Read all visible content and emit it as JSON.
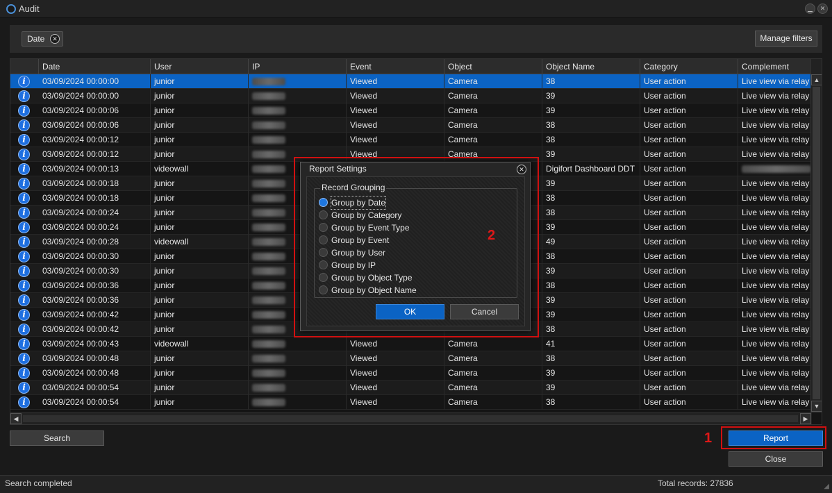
{
  "window": {
    "title": "Audit",
    "icon": "audit-app-icon"
  },
  "filters": {
    "chips": [
      {
        "label": "Date"
      }
    ],
    "manage_label": "Manage filters"
  },
  "table": {
    "columns": [
      "",
      "Date",
      "User",
      "IP",
      "Event",
      "Object",
      "Object Name",
      "Category",
      "Complement"
    ],
    "rows": [
      {
        "date": "03/09/2024 00:00:00",
        "user": "junior",
        "event": "Viewed",
        "object": "Camera",
        "object_name": "38",
        "category": "User action",
        "complement": "Live view via relay",
        "selected": true
      },
      {
        "date": "03/09/2024 00:00:00",
        "user": "junior",
        "event": "Viewed",
        "object": "Camera",
        "object_name": "39",
        "category": "User action",
        "complement": "Live view via relay"
      },
      {
        "date": "03/09/2024 00:00:06",
        "user": "junior",
        "event": "Viewed",
        "object": "Camera",
        "object_name": "39",
        "category": "User action",
        "complement": "Live view via relay"
      },
      {
        "date": "03/09/2024 00:00:06",
        "user": "junior",
        "event": "Viewed",
        "object": "Camera",
        "object_name": "38",
        "category": "User action",
        "complement": "Live view via relay"
      },
      {
        "date": "03/09/2024 00:00:12",
        "user": "junior",
        "event": "Viewed",
        "object": "Camera",
        "object_name": "38",
        "category": "User action",
        "complement": "Live view via relay"
      },
      {
        "date": "03/09/2024 00:00:12",
        "user": "junior",
        "event": "Viewed",
        "object": "Camera",
        "object_name": "39",
        "category": "User action",
        "complement": "Live view via relay"
      },
      {
        "date": "03/09/2024 00:00:13",
        "user": "videowall",
        "event": "",
        "object": "",
        "object_name": "Digifort Dashboard DDT",
        "category": "User action",
        "complement": ""
      },
      {
        "date": "03/09/2024 00:00:18",
        "user": "junior",
        "event": "",
        "object": "",
        "object_name": "39",
        "category": "User action",
        "complement": "Live view via relay"
      },
      {
        "date": "03/09/2024 00:00:18",
        "user": "junior",
        "event": "",
        "object": "",
        "object_name": "38",
        "category": "User action",
        "complement": "Live view via relay"
      },
      {
        "date": "03/09/2024 00:00:24",
        "user": "junior",
        "event": "",
        "object": "",
        "object_name": "38",
        "category": "User action",
        "complement": "Live view via relay"
      },
      {
        "date": "03/09/2024 00:00:24",
        "user": "junior",
        "event": "",
        "object": "",
        "object_name": "39",
        "category": "User action",
        "complement": "Live view via relay"
      },
      {
        "date": "03/09/2024 00:00:28",
        "user": "videowall",
        "event": "",
        "object": "",
        "object_name": "49",
        "category": "User action",
        "complement": "Live view via relay"
      },
      {
        "date": "03/09/2024 00:00:30",
        "user": "junior",
        "event": "",
        "object": "",
        "object_name": "38",
        "category": "User action",
        "complement": "Live view via relay"
      },
      {
        "date": "03/09/2024 00:00:30",
        "user": "junior",
        "event": "",
        "object": "",
        "object_name": "39",
        "category": "User action",
        "complement": "Live view via relay"
      },
      {
        "date": "03/09/2024 00:00:36",
        "user": "junior",
        "event": "",
        "object": "",
        "object_name": "38",
        "category": "User action",
        "complement": "Live view via relay"
      },
      {
        "date": "03/09/2024 00:00:36",
        "user": "junior",
        "event": "",
        "object": "",
        "object_name": "39",
        "category": "User action",
        "complement": "Live view via relay"
      },
      {
        "date": "03/09/2024 00:00:42",
        "user": "junior",
        "event": "",
        "object": "",
        "object_name": "39",
        "category": "User action",
        "complement": "Live view via relay"
      },
      {
        "date": "03/09/2024 00:00:42",
        "user": "junior",
        "event": "",
        "object": "",
        "object_name": "38",
        "category": "User action",
        "complement": "Live view via relay"
      },
      {
        "date": "03/09/2024 00:00:43",
        "user": "videowall",
        "event": "Viewed",
        "object": "Camera",
        "object_name": "41",
        "category": "User action",
        "complement": "Live view via relay"
      },
      {
        "date": "03/09/2024 00:00:48",
        "user": "junior",
        "event": "Viewed",
        "object": "Camera",
        "object_name": "38",
        "category": "User action",
        "complement": "Live view via relay"
      },
      {
        "date": "03/09/2024 00:00:48",
        "user": "junior",
        "event": "Viewed",
        "object": "Camera",
        "object_name": "39",
        "category": "User action",
        "complement": "Live view via relay"
      },
      {
        "date": "03/09/2024 00:00:54",
        "user": "junior",
        "event": "Viewed",
        "object": "Camera",
        "object_name": "39",
        "category": "User action",
        "complement": "Live view via relay"
      },
      {
        "date": "03/09/2024 00:00:54",
        "user": "junior",
        "event": "Viewed",
        "object": "Camera",
        "object_name": "38",
        "category": "User action",
        "complement": "Live view via relay"
      }
    ]
  },
  "dialog": {
    "title": "Report Settings",
    "group_label": "Record Grouping",
    "options": [
      "Group by Date",
      "Group by Category",
      "Group by Event Type",
      "Group by Event",
      "Group by User",
      "Group by IP",
      "Group by Object Type",
      "Group by Object Name"
    ],
    "selected_index": 0,
    "ok_label": "OK",
    "cancel_label": "Cancel"
  },
  "buttons": {
    "search_label": "Search",
    "report_label": "Report",
    "close_label": "Close"
  },
  "annotations": {
    "step1": "1",
    "step2": "2"
  },
  "status": {
    "left": "Search completed",
    "right": "Total records: 27836"
  },
  "colors": {
    "accent": "#0b63c4",
    "annotation": "#d01010"
  }
}
